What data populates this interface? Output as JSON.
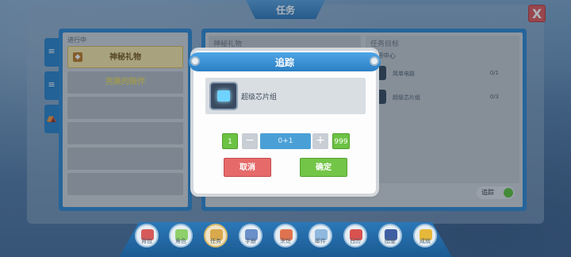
{
  "window": {
    "title": "任务",
    "close_label": "X"
  },
  "left_panel": {
    "header": "进行中",
    "quests": [
      "神秘礼物",
      "完美的陪伴"
    ]
  },
  "right_panel": {
    "section_left_title": "神秘礼物",
    "section_right_title": "任务目标",
    "goal_group": "科研中心",
    "goals": [
      {
        "name": "简单电路",
        "count": "0/1"
      },
      {
        "name": "超级芯片组",
        "count": "0/3"
      }
    ],
    "track_label": "追踪"
  },
  "dialog": {
    "title": "追踪",
    "item_name": "超级芯片组",
    "min_label": "1",
    "minus_label": "−",
    "quantity_value": "0+1",
    "plus_label": "+",
    "max_label": "999",
    "cancel_label": "取消",
    "confirm_label": "确定"
  },
  "bottom_nav": [
    {
      "label": "背包",
      "icon": "backpack-icon",
      "color": "#d65a5a"
    },
    {
      "label": "角色",
      "icon": "character-icon",
      "color": "#8fd06b"
    },
    {
      "label": "任务",
      "icon": "quest-icon",
      "color": "#d9a94c",
      "active": true
    },
    {
      "label": "手册",
      "icon": "hammer-icon",
      "color": "#6b8fc9"
    },
    {
      "label": "烹饪",
      "icon": "cooking-icon",
      "color": "#e0734f"
    },
    {
      "label": "邮件",
      "icon": "mail-icon",
      "color": "#8fb8de"
    },
    {
      "label": "日历",
      "icon": "calendar-icon",
      "color": "#d9524f"
    },
    {
      "label": "图鉴",
      "icon": "book-icon",
      "color": "#3f5fa3"
    },
    {
      "label": "成就",
      "icon": "trophy-icon",
      "color": "#e6b83a"
    }
  ]
}
